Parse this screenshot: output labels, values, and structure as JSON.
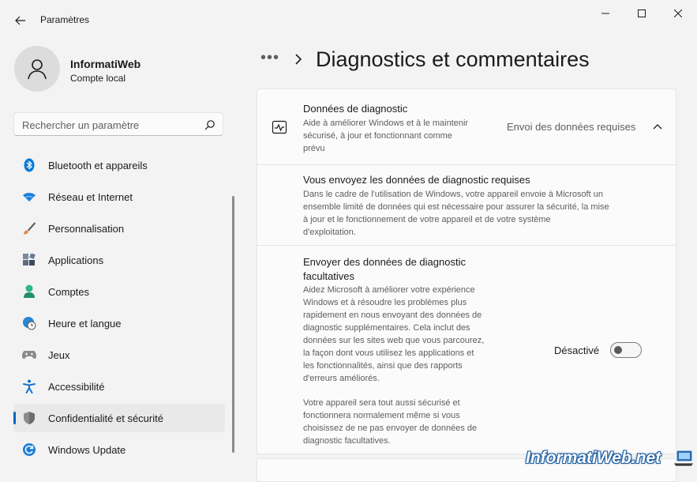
{
  "window": {
    "title": "Paramètres"
  },
  "user": {
    "name": "InformatiWeb",
    "account_type": "Compte local"
  },
  "search": {
    "placeholder": "Rechercher un paramètre"
  },
  "sidebar": {
    "items": [
      {
        "label": "Bluetooth et appareils",
        "icon": "bluetooth-icon"
      },
      {
        "label": "Réseau et Internet",
        "icon": "wifi-icon"
      },
      {
        "label": "Personnalisation",
        "icon": "brush-icon"
      },
      {
        "label": "Applications",
        "icon": "apps-icon"
      },
      {
        "label": "Comptes",
        "icon": "person-icon"
      },
      {
        "label": "Heure et langue",
        "icon": "clock-globe-icon"
      },
      {
        "label": "Jeux",
        "icon": "gamepad-icon"
      },
      {
        "label": "Accessibilité",
        "icon": "accessibility-icon"
      },
      {
        "label": "Confidentialité et sécurité",
        "icon": "shield-icon",
        "active": true
      },
      {
        "label": "Windows Update",
        "icon": "update-icon"
      }
    ]
  },
  "breadcrumb": {
    "dots": "•••",
    "title": "Diagnostics et commentaires"
  },
  "diagnostic_data": {
    "title": "Données de diagnostic",
    "desc_lines": [
      "Aide à améliorer Windows et à le maintenir",
      "sécurisé, à jour et fonctionnant comme",
      "prévu"
    ],
    "status": "Envoi des données requises"
  },
  "required_data": {
    "title": "Vous envoyez les données de diagnostic requises",
    "desc_lines": [
      "Dans le cadre de l'utilisation de Windows, votre appareil envoie à Microsoft un",
      "ensemble limité de données qui est nécessaire pour assurer la sécurité, la mise",
      "à jour et le fonctionnement de votre appareil et de votre système",
      "d'exploitation."
    ]
  },
  "optional_data": {
    "title_lines": [
      "Envoyer des données de diagnostic",
      "facultatives"
    ],
    "desc_lines": [
      "Aidez Microsoft à améliorer votre expérience",
      "Windows et à résoudre les problèmes plus",
      "rapidement en nous envoyant des données de",
      "diagnostic supplémentaires. Cela inclut des",
      "données sur les sites web que vous parcourez,",
      "la façon dont vous utilisez les applications et",
      "les fonctionnalités, ainsi que des rapports",
      "d'erreurs améliorés."
    ],
    "note_lines": [
      "Votre appareil sera tout aussi sécurisé et",
      "fonctionnera normalement même si vous",
      "choisissez de ne pas envoyer de données de",
      "diagnostic facultatives."
    ],
    "toggle_label": "Désactivé",
    "toggle_on": false
  },
  "watermark": {
    "text": "InformatiWeb.net"
  },
  "colors": {
    "accent": "#0067c0",
    "background": "#f3f3f3",
    "card": "#fbfbfb"
  }
}
